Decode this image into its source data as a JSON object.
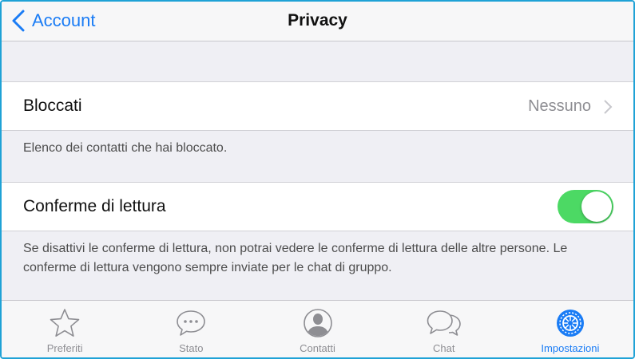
{
  "navbar": {
    "back_label": "Account",
    "title": "Privacy"
  },
  "blocked": {
    "label": "Bloccati",
    "value": "Nessuno",
    "note": "Elenco dei contatti che hai bloccato."
  },
  "read_receipts": {
    "label": "Conferme di lettura",
    "enabled": true,
    "note": "Se disattivi le conferme di lettura, non potrai vedere le conferme di lettura delle altre persone. Le conferme di lettura vengono sempre inviate per le chat di gruppo."
  },
  "tabbar": {
    "items": [
      {
        "label": "Preferiti",
        "icon": "star-icon",
        "active": false
      },
      {
        "label": "Stato",
        "icon": "speech-bubble-icon",
        "active": false
      },
      {
        "label": "Contatti",
        "icon": "contact-person-icon",
        "active": false
      },
      {
        "label": "Chat",
        "icon": "chat-bubbles-icon",
        "active": false
      },
      {
        "label": "Impostazioni",
        "icon": "gear-icon",
        "active": true
      }
    ]
  },
  "colors": {
    "accent": "#1a7cf5",
    "toggle_on": "#4cd964",
    "frame_border": "#1fa2d6"
  }
}
